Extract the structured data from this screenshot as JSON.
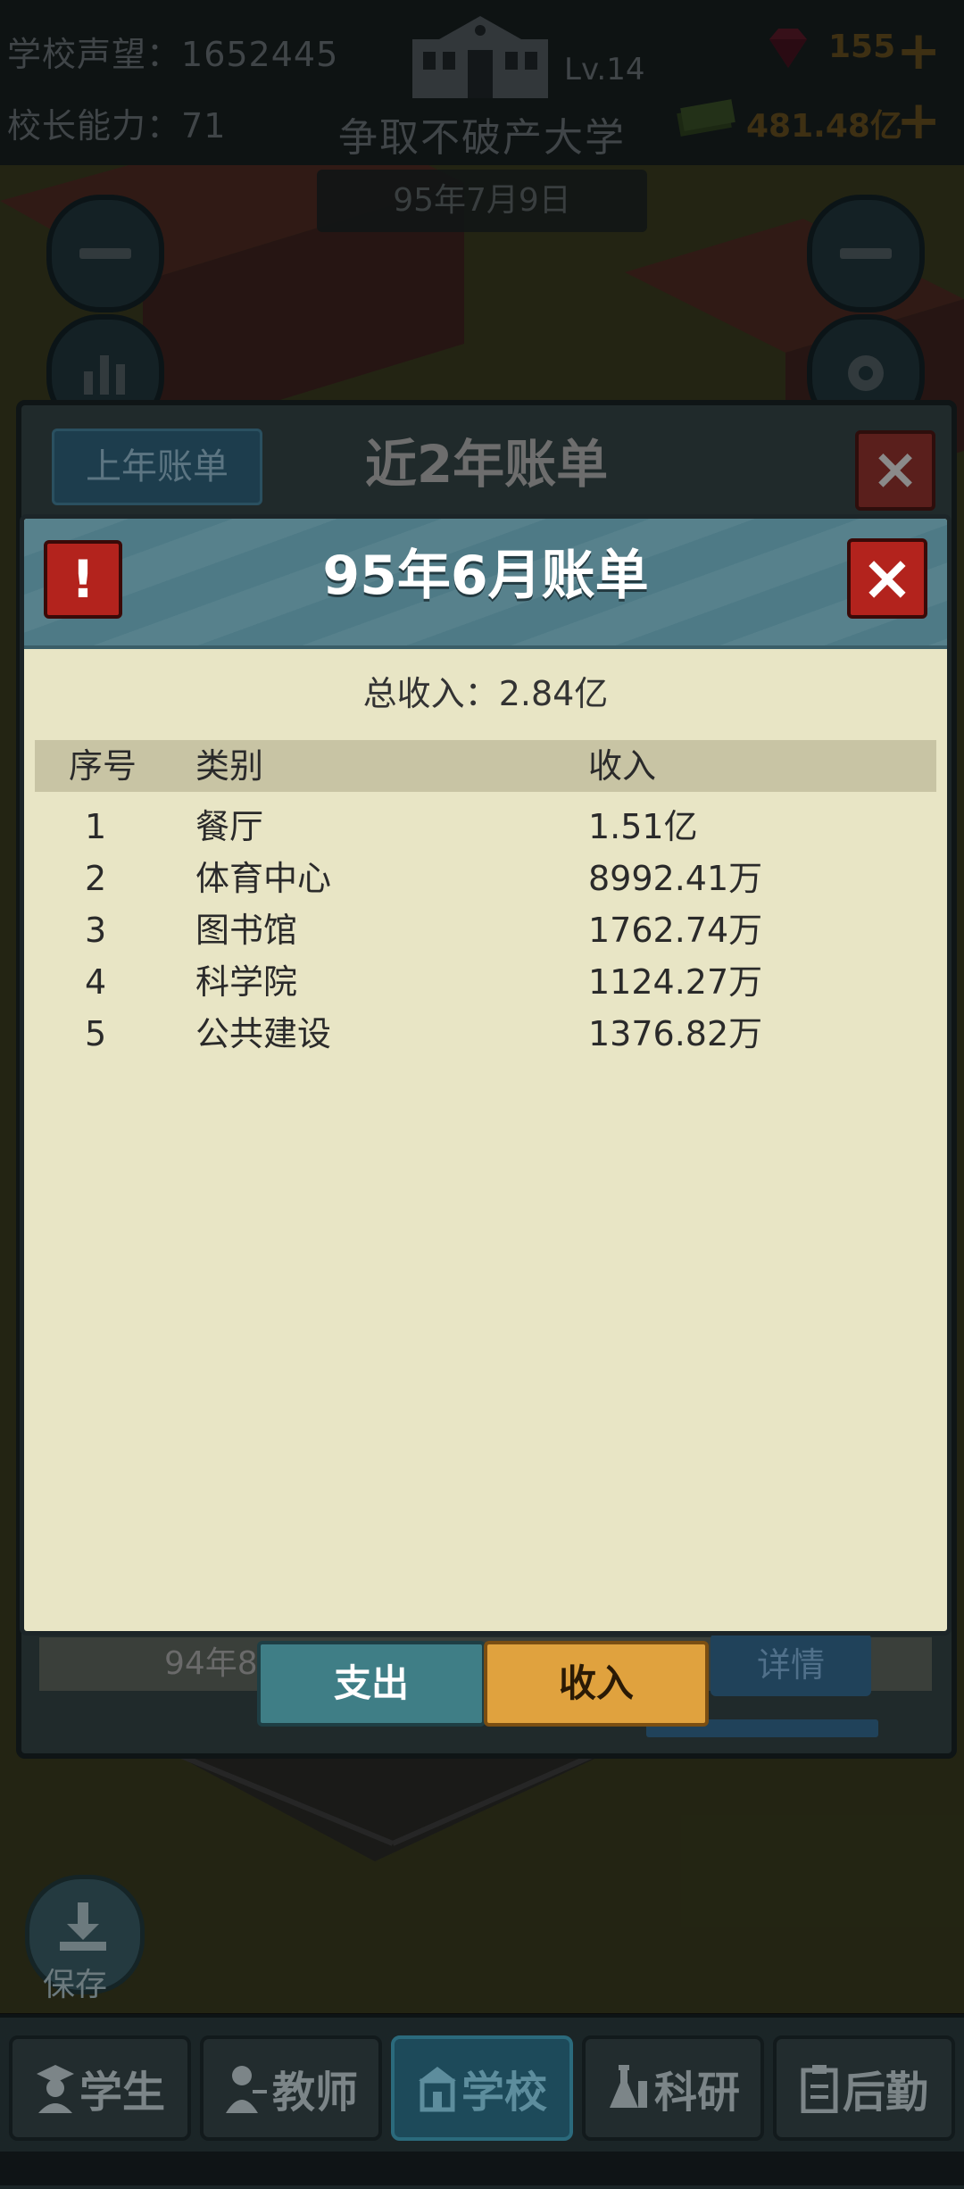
{
  "hud": {
    "reputation_label": "学校声望：",
    "reputation_value": "1652445",
    "ability_label": "校长能力：",
    "ability_value": "71",
    "level": "Lv.14",
    "school_name": "争取不破产大学",
    "date": "95年7月9日",
    "gems": "155",
    "money": "481.48亿",
    "plus_symbol": "+"
  },
  "outer_dialog": {
    "title": "近2年账单",
    "last_year_button": "上年账单",
    "close_symbol": "×",
    "row_label": "94年8月",
    "detail_button": "详情"
  },
  "inner_dialog": {
    "title": "95年6月账单",
    "alert_symbol": "!",
    "close_symbol": "×",
    "total_label": "总收入：",
    "total_value": "2.84亿",
    "columns": {
      "idx": "序号",
      "category": "类别",
      "income": "收入"
    },
    "rows": [
      {
        "idx": "1",
        "category": "餐厅",
        "income": "1.51亿"
      },
      {
        "idx": "2",
        "category": "体育中心",
        "income": "8992.41万"
      },
      {
        "idx": "3",
        "category": "图书馆",
        "income": "1762.74万"
      },
      {
        "idx": "4",
        "category": "科学院",
        "income": "1124.27万"
      },
      {
        "idx": "5",
        "category": "公共建设",
        "income": "1376.82万"
      }
    ]
  },
  "tabs": {
    "expense": "支出",
    "income": "收入",
    "active": "income"
  },
  "save": {
    "label": "保存"
  },
  "nav": {
    "items": [
      {
        "label": "学生",
        "icon": "student-icon"
      },
      {
        "label": "教师",
        "icon": "teacher-icon"
      },
      {
        "label": "学校",
        "icon": "school-icon"
      },
      {
        "label": "科研",
        "icon": "research-icon"
      },
      {
        "label": "后勤",
        "icon": "logistics-icon"
      }
    ],
    "active": "学校"
  },
  "colors": {
    "accent_gold": "#e0a23e",
    "header_teal": "#4e7a86",
    "danger_red": "#b3231d",
    "paper": "#e8e5c5"
  }
}
